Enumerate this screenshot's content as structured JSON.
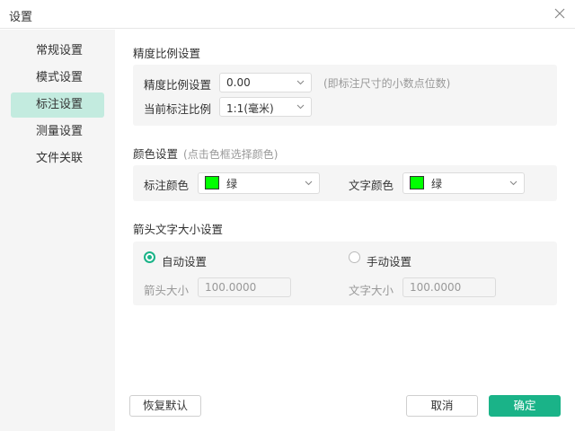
{
  "window": {
    "title": "设置",
    "close_icon": "close-icon"
  },
  "sidebar": {
    "items": [
      {
        "label": "常规设置",
        "active": false
      },
      {
        "label": "模式设置",
        "active": false
      },
      {
        "label": "标注设置",
        "active": true
      },
      {
        "label": "测量设置",
        "active": false
      },
      {
        "label": "文件关联",
        "active": false
      }
    ]
  },
  "precision": {
    "title": "精度比例设置",
    "precision_label": "精度比例设置",
    "precision_value": "0.00",
    "precision_hint": "(即标注尺寸的小数点位数)",
    "scale_label": "当前标注比例",
    "scale_value": "1:1(毫米)"
  },
  "color": {
    "title": "颜色设置",
    "hint": "(点击色框选择颜色)",
    "annotation_label": "标注颜色",
    "annotation_value": "绿",
    "annotation_swatch": "#00ff00",
    "text_label": "文字颜色",
    "text_value": "绿",
    "text_swatch": "#00ff00"
  },
  "arrow": {
    "title": "箭头文字大小设置",
    "auto_label": "自动设置",
    "auto_checked": true,
    "manual_label": "手动设置",
    "manual_checked": false,
    "arrow_size_label": "箭头大小",
    "arrow_size_value": "100.0000",
    "text_size_label": "文字大小",
    "text_size_value": "100.0000"
  },
  "footer": {
    "reset_label": "恢复默认",
    "cancel_label": "取消",
    "ok_label": "确定"
  },
  "colors": {
    "accent": "#1ab388",
    "active_nav": "#c3ebdf",
    "panel_bg": "#f5f5f5"
  }
}
